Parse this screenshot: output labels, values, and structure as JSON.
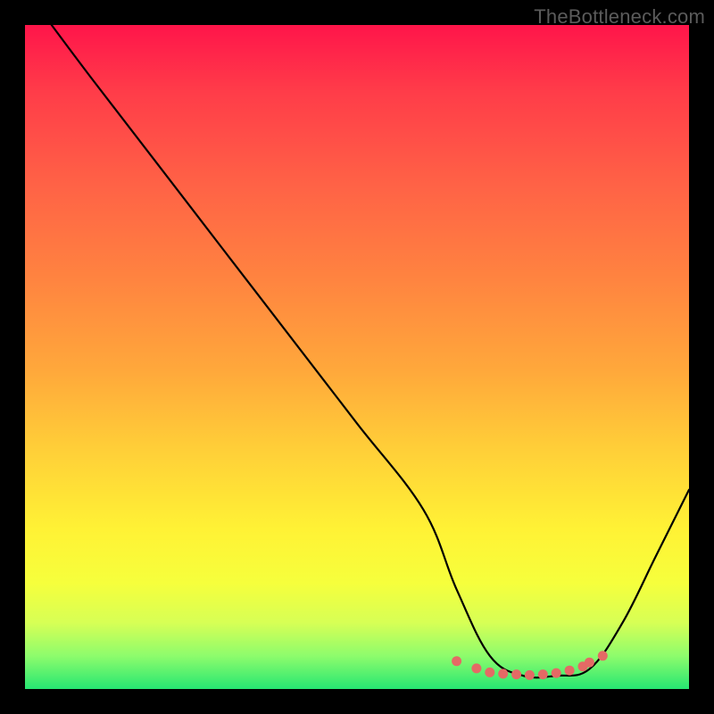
{
  "attribution": "TheBottleneck.com",
  "chart_data": {
    "type": "line",
    "title": "",
    "xlabel": "",
    "ylabel": "",
    "xlim": [
      0,
      100
    ],
    "ylim": [
      0,
      100
    ],
    "series": [
      {
        "name": "bottleneck-curve",
        "x": [
          4,
          10,
          20,
          30,
          40,
          50,
          60,
          65,
          70,
          75,
          80,
          85,
          90,
          95,
          100
        ],
        "y": [
          100,
          92,
          79,
          66,
          53,
          40,
          27,
          15,
          5,
          2,
          2,
          3,
          10,
          20,
          30
        ],
        "color": "#000000"
      },
      {
        "name": "optimal-zone-markers",
        "x": [
          65,
          68,
          70,
          72,
          74,
          76,
          78,
          80,
          82,
          84,
          85,
          87
        ],
        "y": [
          4.2,
          3.1,
          2.5,
          2.3,
          2.2,
          2.1,
          2.2,
          2.4,
          2.8,
          3.4,
          4.0,
          5.0
        ],
        "color": "#e46a65"
      }
    ],
    "gradient_meaning": "red=high bottleneck, green=optimal"
  }
}
